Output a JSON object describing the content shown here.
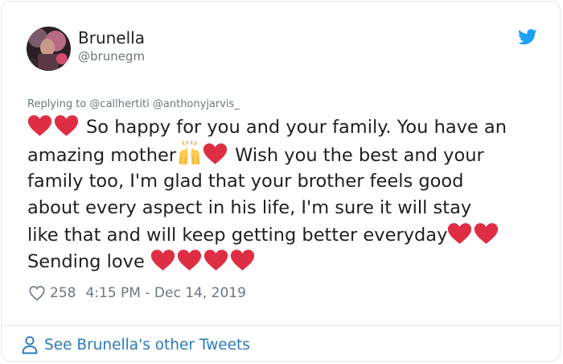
{
  "author": {
    "name": "Brunella",
    "handle": "@brunegm",
    "avatar_icon": "avatar-photo"
  },
  "reply": {
    "label": "Replying to @callhertiti @anthonyjarvis_"
  },
  "tweet": {
    "line1": "So happy for you and your family. You have an",
    "line2a": "amazing mother",
    "line2b": "Wish you the best and your",
    "line3": "family too, I'm glad that your brother feels good",
    "line4": "about every aspect in his life, I'm sure it will stay",
    "line5": "like that and will keep getting better everyday",
    "line6": "Sending love"
  },
  "stats": {
    "likes": "258",
    "timestamp": "4:15 PM - Dec 14, 2019"
  },
  "footer": {
    "see_more": "See Brunella's other Tweets"
  },
  "colors": {
    "text": "#1c2022",
    "secondary": "#697882",
    "link": "#2b7bb9",
    "twitter_blue": "#1da1f2",
    "heart": "#dd2e44"
  }
}
